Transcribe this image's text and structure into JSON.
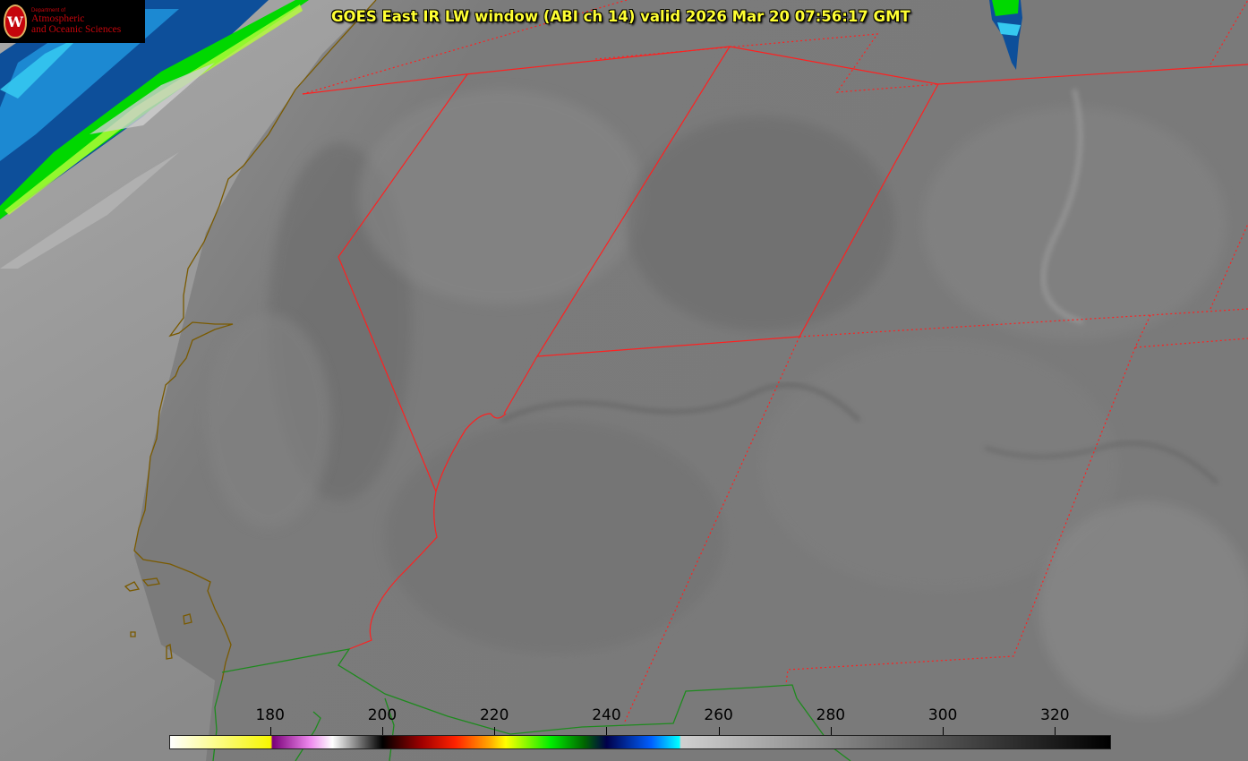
{
  "title": "GOES East IR LW window (ABI ch 14) valid 2026 Mar 20 07:56:17 GMT",
  "logo": {
    "dept": "Department of",
    "line1": "Atmospheric",
    "line2": "and Oceanic Sciences",
    "seal_letter": "W",
    "seal_color": "#c5050c"
  },
  "colorbar": {
    "min": 162,
    "max": 330,
    "tick_values": [
      180,
      200,
      220,
      240,
      260,
      280,
      300,
      320
    ],
    "ticks": [
      "180",
      "200",
      "220",
      "240",
      "260",
      "280",
      "300",
      "320"
    ],
    "stops": [
      {
        "v": 162,
        "c": "#ffffff"
      },
      {
        "v": 180,
        "c": "#f7f700"
      },
      {
        "v": 180.3,
        "c": "#7a0079"
      },
      {
        "v": 187,
        "c": "#ee88ee"
      },
      {
        "v": 191,
        "c": "#ffffff"
      },
      {
        "v": 199,
        "c": "#1a1a1a"
      },
      {
        "v": 200,
        "c": "#000000"
      },
      {
        "v": 207,
        "c": "#a00000"
      },
      {
        "v": 213,
        "c": "#ff2200"
      },
      {
        "v": 219,
        "c": "#ffa500"
      },
      {
        "v": 222,
        "c": "#ffff00"
      },
      {
        "v": 230,
        "c": "#00ee00"
      },
      {
        "v": 236,
        "c": "#006600"
      },
      {
        "v": 240,
        "c": "#00004a"
      },
      {
        "v": 248,
        "c": "#0060ff"
      },
      {
        "v": 253,
        "c": "#00ffff"
      },
      {
        "v": 253.3,
        "c": "#d0d0d0"
      },
      {
        "v": 330,
        "c": "#000000"
      }
    ]
  },
  "map_colors": {
    "state_border": "#ff2020",
    "coastline": "#7a5a00",
    "country_border": "#1e8a1e"
  }
}
